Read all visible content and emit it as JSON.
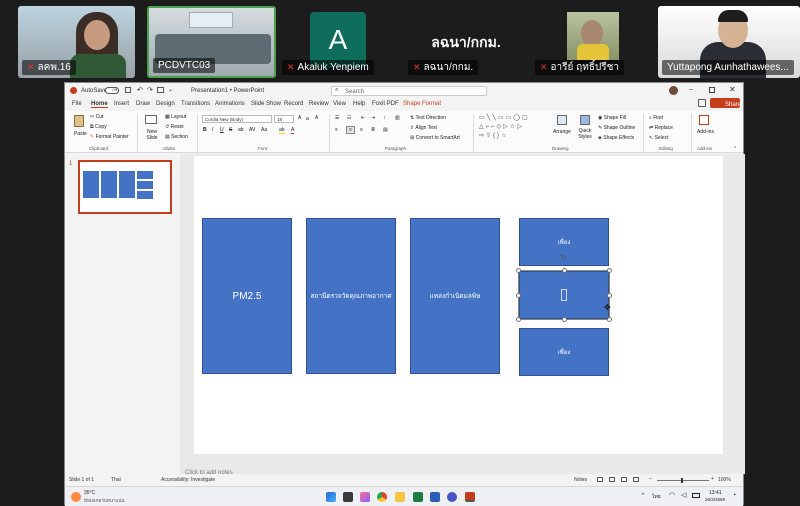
{
  "participants": [
    {
      "name": "ลคพ.16",
      "type": "video"
    },
    {
      "name": "PCDVTC03",
      "type": "video",
      "active_speaker": true
    },
    {
      "name": "Akaluk Yenpiem",
      "type": "avatar",
      "avatar_letter": "A"
    },
    {
      "name": "ลฉนา/กกม.",
      "type": "name_only",
      "display": "ลฉนา/กกม."
    },
    {
      "name": "อารีย์ ฤทธิ์ปรีชา",
      "type": "video"
    },
    {
      "name": "Yuttapong Aunhathawees...",
      "type": "video"
    }
  ],
  "colors": {
    "accent_ppt": "#c43e1c",
    "slide_box": "#4472c4",
    "active_speaker_border": "#4ca04b"
  },
  "titlebar": {
    "autosave": "AutoSave",
    "autosave_state": "Off",
    "doc_title": "Presentation1 • PowerPoint",
    "search_placeholder": "Search"
  },
  "menu": [
    "File",
    "Home",
    "Insert",
    "Draw",
    "Design",
    "Transitions",
    "Animations",
    "Slide Show",
    "Record",
    "Review",
    "View",
    "Help",
    "Foxit PDF",
    "Shape Format"
  ],
  "share_label": "Share",
  "ribbon": {
    "paste": "Paste",
    "cut": "Cut",
    "copy": "Copy",
    "format_painter": "Format Painter",
    "clipboard": "Clipboard",
    "new_slide": "New Slide",
    "layout": "Layout",
    "reset": "Reset",
    "section": "Section",
    "slides": "Slides",
    "font_name": "Cordia New (Body)",
    "font_size": "18",
    "font": "Font",
    "text_direction": "Text Direction",
    "align_text": "Align Text",
    "convert_smartart": "Convert to SmartArt",
    "paragraph": "Paragraph",
    "arrange": "Arrange",
    "quick_styles": "Quick Styles",
    "shape_fill": "Shape Fill",
    "shape_outline": "Shape Outline",
    "shape_effects": "Shape Effects",
    "drawing": "Drawing",
    "find": "Find",
    "replace": "Replace",
    "select": "Select",
    "editing": "Editing",
    "addins": "Add-ins"
  },
  "slide": {
    "number": "1",
    "boxes": [
      {
        "text": "PM2.5"
      },
      {
        "text": "สถานีตรวจวัดคุณภาพอากาศ"
      },
      {
        "text": "แหล่งกำเนิดมลพิษ"
      }
    ],
    "right_boxes": [
      {
        "text": "เพื่อง"
      },
      {
        "text": ""
      },
      {
        "text": "เพื่อง"
      }
    ]
  },
  "notes_placeholder": "Click to add notes",
  "status": {
    "slide_of": "Slide 1 of 1",
    "language": "Thai",
    "accessibility": "Accessibility: Investigate",
    "notes": "Notes",
    "zoom": "100%"
  },
  "taskbar": {
    "weather_temp": "35°C",
    "weather_desc": "มีหมอกควันหนาแน่น",
    "lang": "ไทย",
    "time": "13:41",
    "date": "26/3/2568"
  }
}
